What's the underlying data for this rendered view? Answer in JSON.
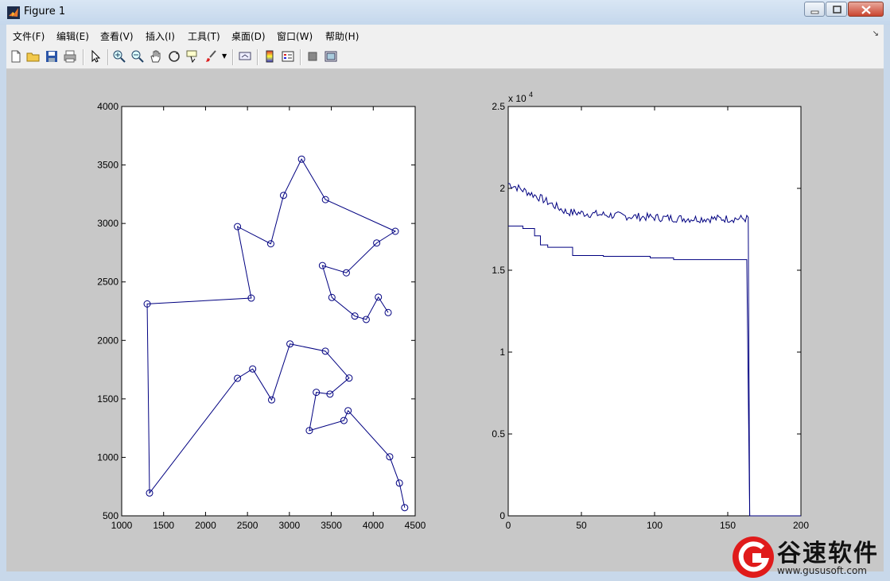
{
  "window": {
    "title": "Figure 1"
  },
  "menu": [
    "文件(F)",
    "编辑(E)",
    "查看(V)",
    "插入(I)",
    "工具(T)",
    "桌面(D)",
    "窗口(W)",
    "帮助(H)"
  ],
  "menu_arrow": "↘",
  "toolbar_icons": [
    "new-figure-icon",
    "open-file-icon",
    "save-icon",
    "print-icon",
    "pointer-icon",
    "zoom-in-icon",
    "zoom-out-icon",
    "pan-hand-icon",
    "rotate-3d-icon",
    "data-cursor-icon",
    "brush-icon",
    "link-plot-icon",
    "colorbar-icon",
    "legend-icon",
    "hide-plot-tools-icon",
    "show-plot-tools-icon"
  ],
  "colors": {
    "line": "#000080",
    "figure_bg": "#c8c8c8",
    "axes_bg": "#ffffff"
  },
  "chart_data": [
    {
      "type": "line",
      "title": "",
      "xlabel": "",
      "ylabel": "",
      "xlim": [
        1000,
        4500
      ],
      "ylim": [
        500,
        4000
      ],
      "xticks": [
        "1000",
        "1500",
        "2000",
        "2500",
        "3000",
        "3500",
        "4000",
        "4500"
      ],
      "yticks": [
        "500",
        "1000",
        "1500",
        "2000",
        "2500",
        "3000",
        "3500",
        "4000"
      ],
      "marker": "circle",
      "grid": false,
      "x": [
        4375,
        4312,
        4196,
        3700,
        3650,
        3238,
        3321,
        3484,
        3712,
        3429,
        3007,
        2788,
        2562,
        2381,
        1332,
        1304,
        2545,
        2381,
        2778,
        2930,
        3145,
        3430,
        4263,
        4041,
        3679,
        3394,
        3507,
        3780,
        3916,
        4061,
        4178
      ],
      "y": [
        570,
        780,
        1005,
        1399,
        1315,
        1229,
        1556,
        1541,
        1678,
        1908,
        1970,
        1491,
        1756,
        1676,
        695,
        2312,
        2362,
        2973,
        2826,
        3240,
        3550,
        3204,
        2933,
        2833,
        2578,
        2640,
        2367,
        2208,
        2179,
        2370,
        2238
      ]
    },
    {
      "type": "line",
      "title": "",
      "xlabel": "",
      "ylabel": "",
      "xlim": [
        0,
        200
      ],
      "ylim": [
        0,
        25000
      ],
      "y_scale_label": "x 10",
      "y_scale_exp": "4",
      "xticks": [
        "0",
        "50",
        "100",
        "150",
        "200"
      ],
      "yticks": [
        "0",
        "0.5",
        "1",
        "1.5",
        "2",
        "2.5"
      ],
      "grid": false,
      "series": [
        {
          "style": "noisy",
          "steps": [
            [
              0,
              20300
            ],
            [
              20,
              19500
            ],
            [
              40,
              18550
            ],
            [
              80,
              18300
            ],
            [
              120,
              18150
            ],
            [
              164,
              18150
            ]
          ],
          "noise": 250,
          "drop": [
            [
              164,
              18200
            ],
            [
              165,
              0
            ],
            [
              200,
              0
            ]
          ]
        },
        {
          "style": "stepped",
          "points": [
            [
              0,
              17700
            ],
            [
              10,
              17700
            ],
            [
              10,
              17550
            ],
            [
              18,
              17550
            ],
            [
              18,
              17100
            ],
            [
              22,
              17100
            ],
            [
              22,
              16550
            ],
            [
              27,
              16550
            ],
            [
              27,
              16400
            ],
            [
              44,
              16400
            ],
            [
              44,
              15900
            ],
            [
              65,
              15900
            ],
            [
              65,
              15850
            ],
            [
              97,
              15850
            ],
            [
              97,
              15750
            ],
            [
              113,
              15750
            ],
            [
              113,
              15650
            ],
            [
              163,
              15650
            ],
            [
              165,
              0
            ],
            [
              200,
              0
            ]
          ]
        }
      ]
    }
  ],
  "watermark": {
    "cn": "谷速软件",
    "url": "www.gususoft.com"
  }
}
